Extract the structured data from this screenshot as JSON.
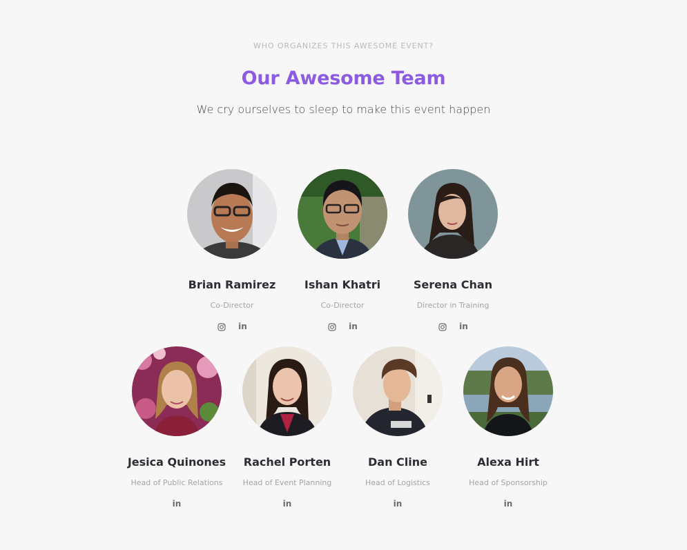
{
  "section": {
    "eyebrow": "WHO ORGANIZES THIS AWESOME EVENT?",
    "title": "Our Awesome Team",
    "subtitle": "We cry ourselves to sleep to make this event happen"
  },
  "colors": {
    "accent": "#8c5be0",
    "background": "#f7f7f7",
    "name_text": "#2d2d33",
    "role_text": "#a3a3a8",
    "icon": "#6b6b70"
  },
  "team": [
    {
      "name": "Brian Ramirez",
      "role": "Co-Director",
      "socials": [
        "instagram-icon",
        "linkedin-icon"
      ]
    },
    {
      "name": "Ishan Khatri",
      "role": "Co-Director",
      "socials": [
        "instagram-icon",
        "linkedin-icon"
      ]
    },
    {
      "name": "Serena Chan",
      "role": "Director in Training",
      "socials": [
        "instagram-icon",
        "linkedin-icon"
      ]
    },
    {
      "name": "Jesica Quinones",
      "role": "Head of Public Relations",
      "socials": [
        "linkedin-icon"
      ]
    },
    {
      "name": "Rachel Porten",
      "role": "Head of Event Planning",
      "socials": [
        "linkedin-icon"
      ]
    },
    {
      "name": "Dan Cline",
      "role": "Head of Logistics",
      "socials": [
        "linkedin-icon"
      ]
    },
    {
      "name": "Alexa Hirt",
      "role": "Head of Sponsorship",
      "socials": [
        "linkedin-icon"
      ]
    }
  ]
}
